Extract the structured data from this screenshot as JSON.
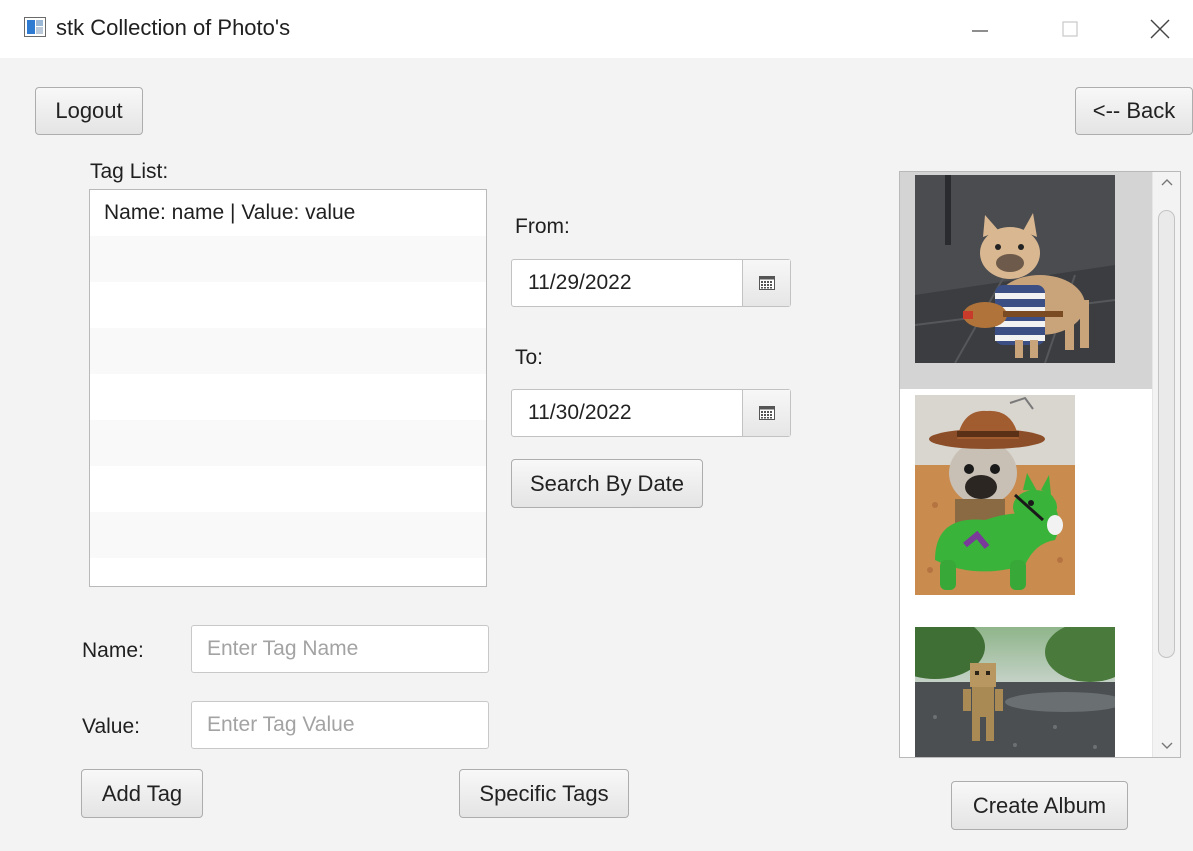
{
  "window": {
    "title": "stk Collection of Photo's",
    "icon": "app-window-icon",
    "controls": [
      "minimize-icon",
      "maximize-icon",
      "close-icon"
    ]
  },
  "toolbar": {
    "logout_label": "Logout",
    "back_label": "<-- Back"
  },
  "tag_list": {
    "label": "Tag List:",
    "items": [
      "Name: name | Value: value"
    ]
  },
  "date_search": {
    "from_label": "From:",
    "from_value": "11/29/2022",
    "to_label": "To:",
    "to_value": "11/30/2022",
    "picker_icon": "calendar-icon",
    "search_label": "Search By Date"
  },
  "tag_form": {
    "name_label": "Name:",
    "name_placeholder": "Enter Tag Name",
    "value_label": "Value:",
    "value_placeholder": "Enter Tag Value",
    "add_label": "Add Tag",
    "specific_label": "Specific Tags"
  },
  "photos": {
    "items": [
      {
        "name": "french-bulldog-guitar-photo",
        "selected": true
      },
      {
        "name": "pug-cowboy-hat-photo",
        "selected": false
      },
      {
        "name": "cardboard-robot-rain-photo",
        "selected": false
      }
    ],
    "create_album_label": "Create Album"
  },
  "colors": {
    "background": "#f3f3f3",
    "selected_row": "#d4d4d4"
  }
}
